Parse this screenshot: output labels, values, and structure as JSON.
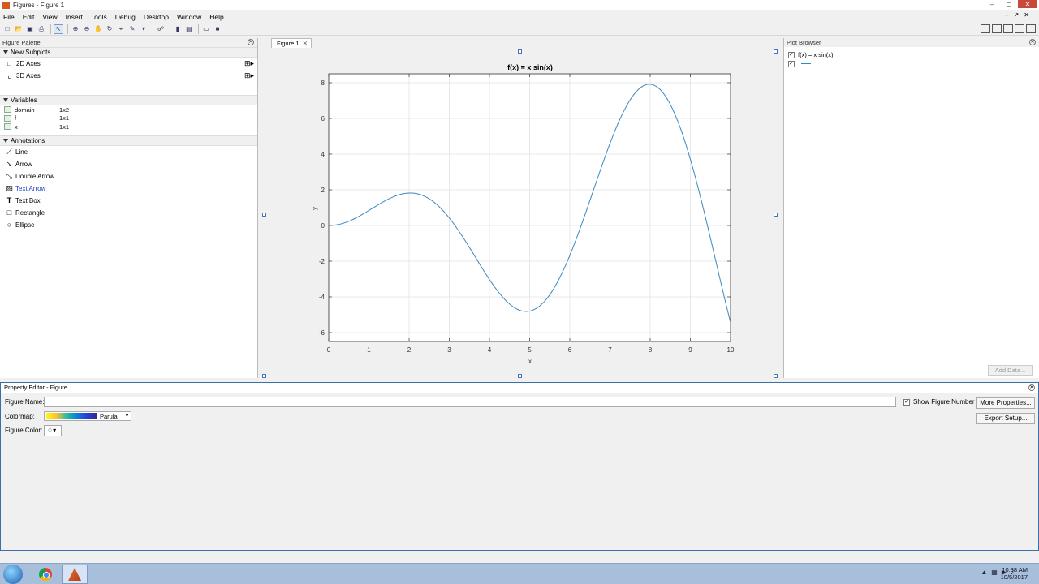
{
  "window": {
    "title": "Figures - Figure 1"
  },
  "menu": [
    "File",
    "Edit",
    "View",
    "Insert",
    "Tools",
    "Debug",
    "Desktop",
    "Window",
    "Help"
  ],
  "palette": {
    "header": "Figure Palette",
    "new_subplots": {
      "label": "New Subplots",
      "items": [
        "2D Axes",
        "3D Axes"
      ]
    },
    "variables": {
      "label": "Variables",
      "items": [
        {
          "name": "domain",
          "size": "1x2"
        },
        {
          "name": "f",
          "size": "1x1"
        },
        {
          "name": "x",
          "size": "1x1"
        }
      ]
    },
    "annotations": {
      "label": "Annotations",
      "items": [
        "Line",
        "Arrow",
        "Double Arrow",
        "Text Arrow",
        "Text Box",
        "Rectangle",
        "Ellipse"
      ]
    }
  },
  "figure_tab": {
    "label": "Figure 1"
  },
  "plot_browser": {
    "header": "Plot Browser",
    "items": [
      "f(x) = x sin(x)"
    ],
    "add_data": "Add Data..."
  },
  "property_editor": {
    "header": "Property Editor - Figure",
    "figure_name_label": "Figure Name:",
    "figure_name_value": "",
    "show_figure_number": "Show Figure Number",
    "more_properties": "More Properties...",
    "export_setup": "Export Setup...",
    "colormap_label": "Colormap:",
    "colormap_value": "Parula",
    "figure_color_label": "Figure Color:"
  },
  "taskbar": {
    "time": "10:38 AM",
    "date": "10/5/2017"
  },
  "colors": {
    "line": "#3a88c0",
    "accent": "#3a6ea5"
  },
  "chart_data": {
    "type": "line",
    "title": "f(x) = x sin(x)",
    "xlabel": "x",
    "ylabel": "y",
    "xlim": [
      0,
      10
    ],
    "ylim": [
      -6.5,
      8.5
    ],
    "xticks": [
      0,
      1,
      2,
      3,
      4,
      5,
      6,
      7,
      8,
      9,
      10
    ],
    "yticks": [
      -6,
      -4,
      -2,
      0,
      2,
      4,
      6,
      8
    ],
    "grid": true,
    "function": "x*sin(x)"
  }
}
